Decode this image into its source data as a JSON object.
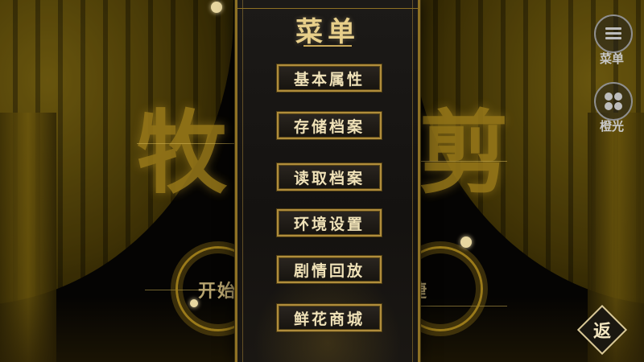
{
  "menu": {
    "title": "菜单",
    "items": [
      {
        "label": "基本属性"
      },
      {
        "label": "存储档案"
      },
      {
        "label": "读取档案"
      },
      {
        "label": "环境设置"
      },
      {
        "label": "剧情回放"
      },
      {
        "label": "鲜花商城"
      }
    ]
  },
  "background": {
    "title_left": "牧",
    "title_right": "剪",
    "label_left": "开始",
    "label_right": "快捷"
  },
  "side": {
    "menu_icon": "menu-lines-icon",
    "menu_label": "菜单",
    "orange_icon": "clover-icon",
    "orange_label": "橙光"
  },
  "back": {
    "label": "返",
    "icon": "diamond-frame-icon"
  },
  "colors": {
    "gold": "#b08d3c",
    "gold_text": "#f0e2b8",
    "panel_bg": "#1c1a18",
    "side_gray": "#bdbdbd"
  }
}
